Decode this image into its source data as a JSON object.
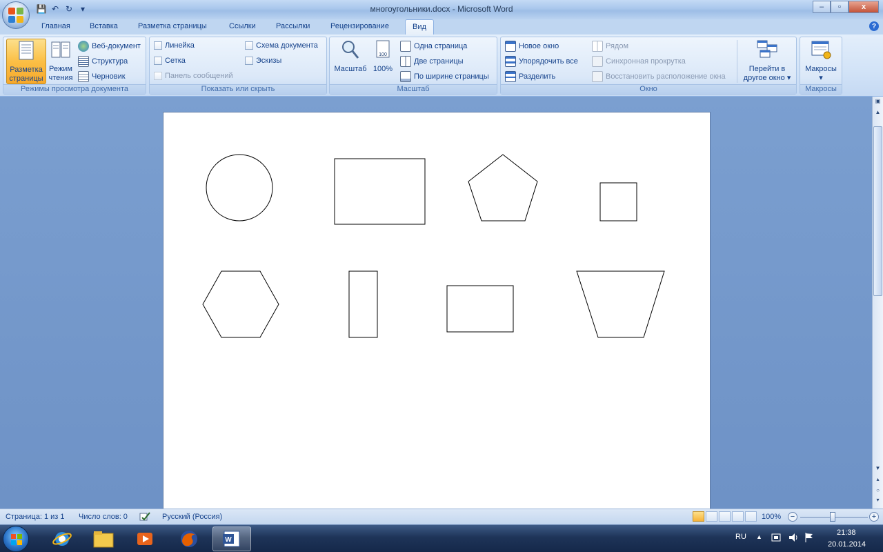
{
  "window": {
    "title": "многоугольники.docx - Microsoft Word",
    "minimize": "–",
    "maximize": "▫",
    "close": "x",
    "help": "?"
  },
  "qat": {
    "save_icon": "💾",
    "undo_icon": "↶",
    "redo_icon": "↻",
    "customize_icon": "▾"
  },
  "tabs": [
    "Главная",
    "Вставка",
    "Разметка страницы",
    "Ссылки",
    "Рассылки",
    "Рецензирование",
    "Вид"
  ],
  "active_tab": "Вид",
  "ribbon": {
    "doc_views": {
      "label": "Режимы просмотра документа",
      "print_layout": [
        "Разметка",
        "страницы"
      ],
      "reading": [
        "Режим",
        "чтения"
      ],
      "web": "Веб-документ",
      "outline": "Структура",
      "draft": "Черновик"
    },
    "show_hide": {
      "label": "Показать или скрыть",
      "ruler": "Линейка",
      "gridlines": "Сетка",
      "message_bar": "Панель сообщений",
      "doc_map": "Схема документа",
      "thumbnails": "Эскизы"
    },
    "zoom": {
      "label": "Масштаб",
      "zoom_btn": "Масштаб",
      "hundred": "100%",
      "one_page": "Одна страница",
      "two_pages": "Две страницы",
      "page_width": "По ширине страницы"
    },
    "window": {
      "label": "Окно",
      "new_window": "Новое окно",
      "arrange_all": "Упорядочить все",
      "split": "Разделить",
      "side_by_side": "Рядом",
      "sync_scroll": "Синхронная прокрутка",
      "reset_position": "Восстановить расположение окна",
      "switch": [
        "Перейти в",
        "другое окно"
      ]
    },
    "macros": {
      "label": "Макросы",
      "macros_btn": "Макросы"
    }
  },
  "status": {
    "page": "Страница: 1 из 1",
    "words": "Число слов: 0",
    "language": "Русский (Россия)",
    "zoom": "100%",
    "zoom_minus": "−",
    "zoom_plus": "+"
  },
  "taskbar": {
    "lang": "RU",
    "time": "21:38",
    "date": "20.01.2014"
  },
  "colors": {
    "ribbon_text": "#15428b",
    "active_button": "#fbbf46",
    "doc_background": "#6e92c6"
  }
}
